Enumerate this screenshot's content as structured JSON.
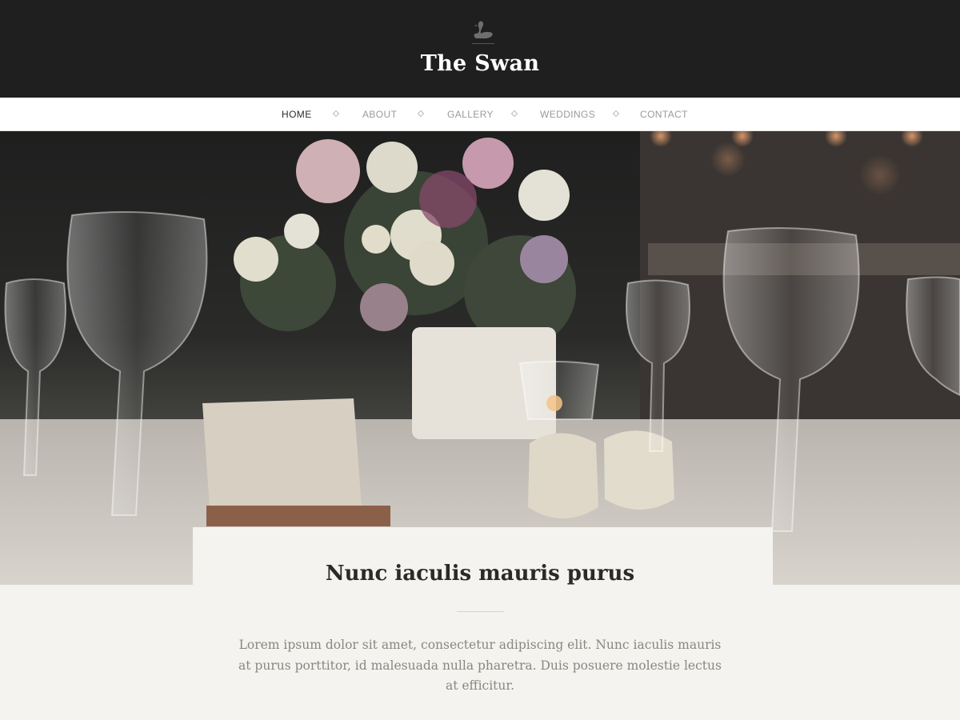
{
  "site": {
    "title": "The Swan",
    "logo_icon": "swan-icon"
  },
  "nav": {
    "items": [
      {
        "label": "HOME",
        "active": true
      },
      {
        "label": "ABOUT",
        "active": false
      },
      {
        "label": "GALLERY",
        "active": false
      },
      {
        "label": "WEDDINGS",
        "active": false
      },
      {
        "label": "CONTACT",
        "active": false
      }
    ],
    "separator_icon": "diamond-icon"
  },
  "hero": {
    "image_subject": "wedding-table-setting-photo"
  },
  "intro": {
    "heading": "Nunc iaculis mauris purus",
    "body": "Lorem ipsum dolor sit amet, consectetur adipiscing elit. Nunc iaculis mauris at purus porttitor, id malesuada nulla pharetra. Duis posuere molestie lectus at efficitur."
  },
  "colors": {
    "header_bg": "#1f1f1f",
    "nav_bg": "#ffffff",
    "page_bg": "#f5f3ef",
    "active_nav": "#2b2b2b",
    "inactive_nav": "#9a9a9a"
  }
}
